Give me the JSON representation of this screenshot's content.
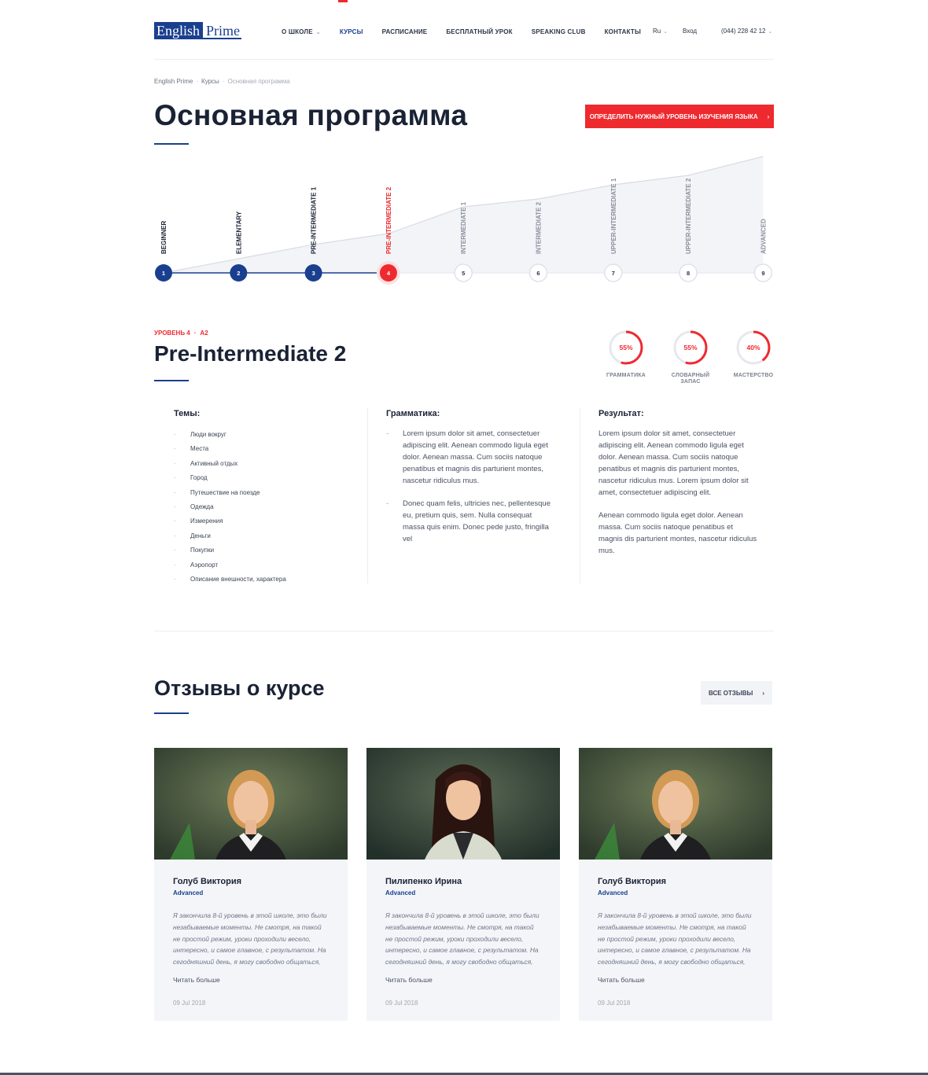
{
  "header": {
    "logo_part1": "English",
    "logo_part2": "Prime",
    "nav": [
      {
        "label": "О ШКОЛЕ",
        "has_dropdown": true
      },
      {
        "label": "КУРСЫ",
        "active": true
      },
      {
        "label": "РАСПИСАНИЕ"
      },
      {
        "label": "БЕСПЛАТНЫЙ УРОК"
      },
      {
        "label": "SPEAKING CLUB"
      },
      {
        "label": "КОНТАКТЫ"
      }
    ],
    "language": "Ru",
    "login": "Вход",
    "phone": "(044) 228 42 12"
  },
  "breadcrumb": [
    "English Prime",
    "Курсы",
    "Основная программа"
  ],
  "page_title": "Основная программа",
  "cta_label": "ОПРЕДЕЛИТЬ НУЖНЫЙ УРОВЕНЬ ИЗУЧЕНИЯ ЯЗЫКА",
  "levels": {
    "current": 4,
    "items": [
      {
        "num": "1",
        "name": "BEGINNER"
      },
      {
        "num": "2",
        "name": "ELEMENTARY"
      },
      {
        "num": "3",
        "name": "PRE-INTERMEDIATE 1"
      },
      {
        "num": "4",
        "name": "PRE-INTERMEDIATE 2"
      },
      {
        "num": "5",
        "name": "INTERMEDIATE 1"
      },
      {
        "num": "6",
        "name": "INTERMEDIATE 2"
      },
      {
        "num": "7",
        "name": "UPPER-INTERMEDIATE 1"
      },
      {
        "num": "8",
        "name": "UPPER-INTERMEDIATE 2"
      },
      {
        "num": "9",
        "name": "ADVANCED"
      }
    ],
    "colors": {
      "done": "#1a3f8f",
      "current": "#ee2a2f",
      "future_border": "#dfe2e8",
      "area": "#f3f4f8"
    }
  },
  "level_info": {
    "tag_level": "УРОВЕНЬ 4",
    "tag_code": "A2",
    "title": "Pre-Intermediate 2",
    "stats": [
      {
        "value": "55%",
        "percent": 55,
        "label": "ГРАММАТИКА"
      },
      {
        "value": "55%",
        "percent": 55,
        "label_line1": "СЛОВАРНЫЙ",
        "label_line2": "ЗАПАС"
      },
      {
        "value": "40%",
        "percent": 40,
        "label": "МАСТЕРСТВО"
      }
    ]
  },
  "columns": {
    "topics": {
      "title": "Темы:",
      "items": [
        "Люди вокруг",
        "Места",
        "Активный отдых",
        "Город",
        "Путешествие на поезде",
        "Одежда",
        "Измерения",
        "Деньги",
        "Покупки",
        "Аэропорт",
        "Описание внешности, характера"
      ]
    },
    "grammar": {
      "title": "Грамматика:",
      "items": [
        "Lorem ipsum dolor sit amet, consectetuer adipiscing elit. Aenean commodo ligula eget dolor. Aenean massa. Cum sociis natoque penatibus et magnis dis parturient montes, nascetur ridiculus mus.",
        "Donec quam felis, ultricies nec, pellentesque eu, pretium quis, sem. Nulla consequat massa quis enim. Donec pede justo, fringilla vel"
      ]
    },
    "result": {
      "title": "Результат:",
      "paragraphs": [
        "Lorem ipsum dolor sit amet, consectetuer adipiscing elit. Aenean commodo ligula eget dolor. Aenean massa. Cum sociis natoque penatibus et magnis dis parturient montes, nascetur ridiculus mus. Lorem ipsum dolor sit amet, consectetuer adipiscing elit.",
        "Aenean commodo ligula eget dolor. Aenean massa. Cum sociis natoque penatibus et magnis dis parturient montes, nascetur ridiculus mus."
      ]
    }
  },
  "reviews": {
    "title": "Отзывы о курсе",
    "all_label": "ВСЕ ОТЗЫВЫ",
    "items": [
      {
        "name": "Голуб Виктория",
        "level": "Advanced",
        "text": "Я закончила 8-й уровень в этой школе, это были незабываемые моменты. Не смотря, на такой не простой режим, уроки проходили весело, интересно, и самое главное, с результатом. На сегодняшний день, я могу свободно общаться,",
        "more": "Читать больше",
        "date": "09 Jul 2018"
      },
      {
        "name": "Пилипенко Ирина",
        "level": "Advanced",
        "text": "Я закончила 8-й уровень в этой школе, это были незабываемые моменты. Не смотря, на такой не простой режим, уроки проходили весело, интересно, и самое главное, с результатом. На сегодняшний день, я могу свободно общаться,",
        "more": "Читать больше",
        "date": "09 Jul 2018"
      },
      {
        "name": "Голуб Виктория",
        "level": "Advanced",
        "text": "Я закончила 8-й уровень в этой школе, это были незабываемые моменты. Не смотря, на такой не простой режим, уроки проходили весело, интересно, и самое главное, с результатом. На сегодняшний день, я могу свободно общаться,",
        "more": "Читать больше",
        "date": "09 Jul 2018"
      }
    ]
  },
  "colors": {
    "brand": "#1a3f8f",
    "accent": "#ee2a2f",
    "text": "#1a2235"
  }
}
